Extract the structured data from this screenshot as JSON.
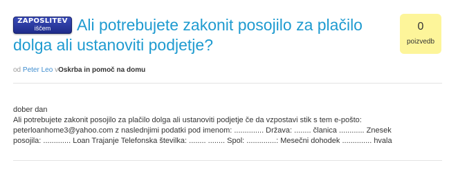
{
  "badge": {
    "top": "ZAPOSLITEV",
    "bottom": "iščem"
  },
  "question": {
    "title": "Ali potrebujete zakonit posojilo za plačilo dolga ali ustanoviti podjetje?"
  },
  "votes": {
    "count": "0",
    "label": "poizvedb"
  },
  "meta": {
    "by_label": "od",
    "author": "Peter Leo",
    "in_label": "v",
    "category": "Oskrba in pomoč na domu"
  },
  "body": {
    "lines": [
      "dober dan",
      "Ali potrebujete zakonit posojilo za plačilo dolga ali ustanoviti podjetje če da vzpostavi stik s tem e-pošto:",
      "peterloanhome3@yahoo.com z naslednjimi podatki pod imenom: .............. Država: ........ članica ............ Znesek",
      "posojila: ............. Loan Trajanje Telefonska številka: ........ ........ Spol: ..............: Mesečni dohodek .............. hvala"
    ]
  }
}
